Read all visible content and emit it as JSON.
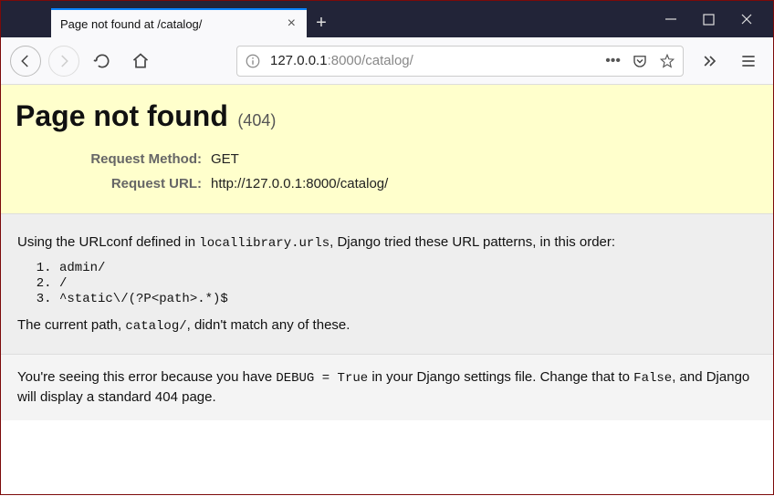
{
  "tab": {
    "title": "Page not found at /catalog/"
  },
  "urlbar": {
    "host": "127.0.0.1",
    "port": ":8000",
    "path": "/catalog/"
  },
  "error": {
    "heading": "Page not found",
    "code": "(404)",
    "method_label": "Request Method:",
    "method": "GET",
    "url_label": "Request URL:",
    "url": "http://127.0.0.1:8000/catalog/"
  },
  "body": {
    "lead_a": "Using the URLconf defined in ",
    "urlconf": "locallibrary.urls",
    "lead_b": ", Django tried these URL patterns, in this order:",
    "patterns": [
      "admin/",
      "/",
      "^static\\/(?P<path>.*)$"
    ],
    "tail_a": "The current path, ",
    "current": "catalog/",
    "tail_b": ", didn't match any of these."
  },
  "footer": {
    "a": "You're seeing this error because you have ",
    "debug": "DEBUG = True",
    "b": " in your Django settings file. Change that to ",
    "false": "False",
    "c": ", and Django will display a standard 404 page."
  }
}
